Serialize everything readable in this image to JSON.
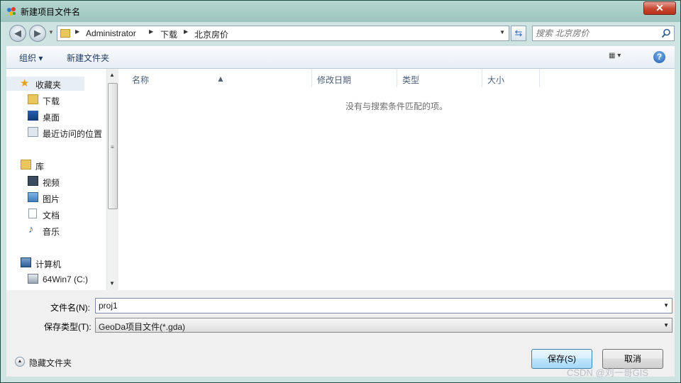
{
  "window": {
    "title": "新建项目文件名",
    "close_label": "✕"
  },
  "nav": {
    "address_path": [
      "Administrator",
      "下载",
      "北京房价"
    ],
    "search_placeholder": "搜索 北京房价"
  },
  "toolbar": {
    "organize_label": "组织 ▾",
    "new_folder_label": "新建文件夹",
    "view_label": "▦ ▾",
    "help_label": "?"
  },
  "sidebar": {
    "favorites": {
      "label": "收藏夹",
      "items": [
        "下载",
        "桌面",
        "最近访问的位置"
      ]
    },
    "libraries": {
      "label": "库",
      "items": [
        "视频",
        "图片",
        "文档",
        "音乐"
      ]
    },
    "computer": {
      "label": "计算机",
      "items": [
        "64Win7 (C:)"
      ]
    }
  },
  "file_list": {
    "columns": [
      "名称",
      "修改日期",
      "类型",
      "大小"
    ],
    "empty_message": "没有与搜索条件匹配的项。"
  },
  "form": {
    "filename_label": "文件名(N):",
    "filename_value": "proj1",
    "filetype_label": "保存类型(T):",
    "filetype_value": "GeoDa项目文件(*.gda)"
  },
  "footer": {
    "hide_folders_label": "隐藏文件夹",
    "save_label": "保存(S)",
    "cancel_label": "取消"
  },
  "watermark": "CSDN @刘一哥GIS"
}
